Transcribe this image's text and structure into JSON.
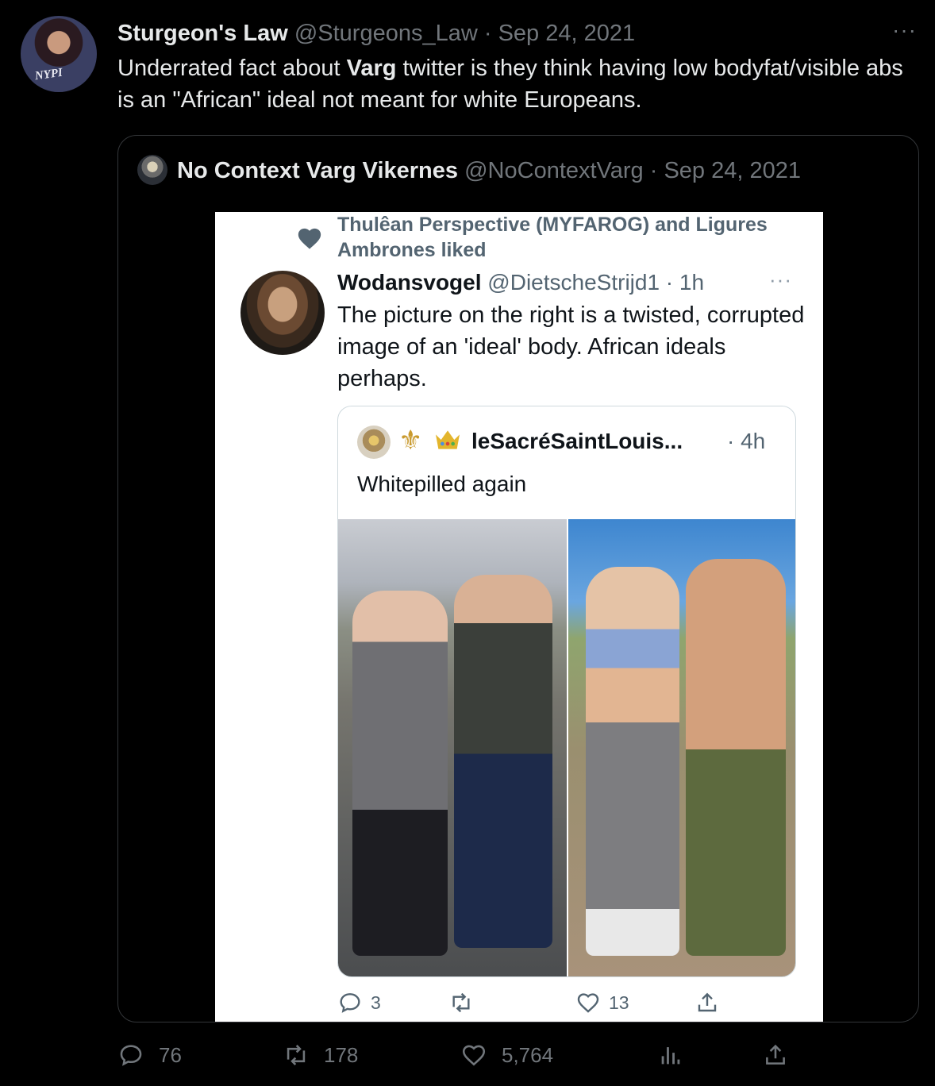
{
  "tweet": {
    "display_name": "Sturgeon's Law",
    "handle_date": "@Sturgeons_Law · Sep 24, 2021",
    "more": "···",
    "avatar_text": "NYPI",
    "text_part1": "Underrated fact about ",
    "text_bold": "Varg",
    "text_part2": " twitter is they think having low bodyfat/visible abs is an \"African\" ideal not meant for white Europeans."
  },
  "quoted": {
    "display_name": "No Context Varg Vikernes",
    "handle_date": "@NoContextVarg · Sep 24, 2021"
  },
  "screenshot": {
    "liked_text": "Thulêan Perspective (MYFAROG) and Ligures Ambrones liked",
    "display_name": "Wodansvogel",
    "handle_time": "@DietscheStrijd1 · 1h",
    "more": "···",
    "text": "The picture on the right is a twisted, corrupted image of an 'ideal' body. African ideals perhaps.",
    "inner": {
      "fleur": "⚜",
      "name": "leSacréSaintLouis...",
      "time": "· 4h",
      "text": "Whitepilled again"
    },
    "actions": {
      "replies": "3",
      "likes": "13"
    }
  },
  "actions": {
    "replies": "76",
    "retweets": "178",
    "likes": "5,764"
  },
  "colors": {
    "background": "#000000",
    "text": "#e7e9ea",
    "muted": "#71767b",
    "border": "#333639"
  }
}
